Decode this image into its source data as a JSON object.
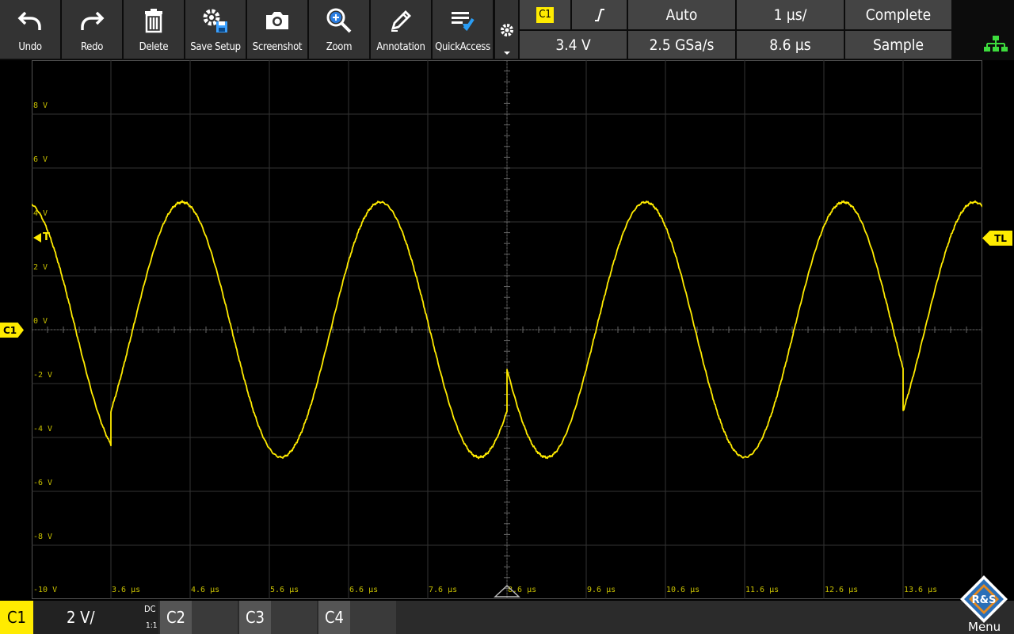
{
  "toolbar": {
    "buttons": [
      {
        "label": "Undo",
        "icon": "undo-icon"
      },
      {
        "label": "Redo",
        "icon": "redo-icon"
      },
      {
        "label": "Delete",
        "icon": "trash-icon"
      },
      {
        "label": "Save Setup",
        "icon": "save-setup-icon"
      },
      {
        "label": "Screenshot",
        "icon": "camera-icon"
      },
      {
        "label": "Zoom",
        "icon": "zoom-icon"
      },
      {
        "label": "Annotation",
        "icon": "pen-icon"
      },
      {
        "label": "QuickAccess",
        "icon": "quick-access-icon"
      }
    ]
  },
  "status": {
    "trigger_source": "C1",
    "trigger_slope": "rising-edge-icon",
    "trigger_mode": "Auto",
    "timebase": "1 µs/",
    "acq_state": "Complete",
    "trigger_level": "3.4 V",
    "sample_rate": "2.5 GSa/s",
    "trigger_position": "8.6 µs",
    "acq_mode": "Sample"
  },
  "waveform": {
    "color": "#ffeb00",
    "y_labels": [
      "8 V",
      "6 V",
      "4 V",
      "2 V",
      "0 V",
      "-2 V",
      "-4 V",
      "-6 V",
      "-8 V",
      "-10 V"
    ],
    "x_labels": [
      "3.6 µs",
      "4.6 µs",
      "5.6 µs",
      "6.6 µs",
      "7.6 µs",
      "8.6 µs",
      "9.6 µs",
      "10.6 µs",
      "11.6 µs",
      "12.6 µs",
      "13.6 µs"
    ],
    "trigger_marker": "T",
    "trigger_level_marker": "TL",
    "channel_marker": "C1"
  },
  "bottom": {
    "c1_label": "C1",
    "c1_scale": "2 V/",
    "c1_coupling": "DC",
    "c1_probe": "1:1",
    "c2_label": "C2",
    "c3_label": "C3",
    "c4_label": "C4",
    "menu_label": "Menu",
    "logo_text": "R&S"
  }
}
